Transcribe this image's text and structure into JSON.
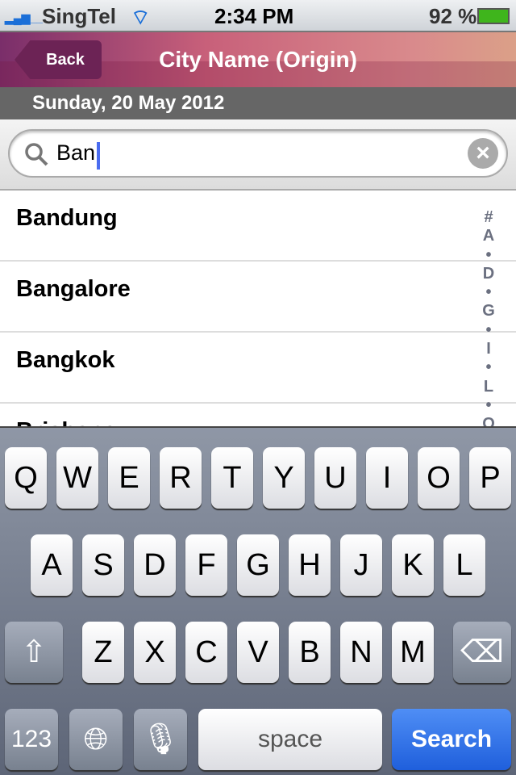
{
  "status": {
    "carrier": "SingTel",
    "time": "2:34 PM",
    "battery": "92 %",
    "battery_level": 0.92
  },
  "nav": {
    "back_label": "Back",
    "title": "City Name (Origin)"
  },
  "date": "Sunday, 20 May 2012",
  "search": {
    "value": "Ban",
    "search_icon": "magnifier-icon",
    "clear_icon": "clear-icon"
  },
  "results": [
    "Bandung",
    "Bangalore",
    "Bangkok",
    "Brisbane"
  ],
  "index": [
    "#",
    "A",
    "•",
    "D",
    "•",
    "G",
    "•",
    "I",
    "•",
    "L",
    "•",
    "O"
  ],
  "keyboard": {
    "row1": [
      "Q",
      "W",
      "E",
      "R",
      "T",
      "Y",
      "U",
      "I",
      "O",
      "P"
    ],
    "row2": [
      "A",
      "S",
      "D",
      "F",
      "G",
      "H",
      "J",
      "K",
      "L"
    ],
    "row3": [
      "Z",
      "X",
      "C",
      "V",
      "B",
      "N",
      "M"
    ],
    "numbers": "123",
    "space": "space",
    "search": "Search"
  },
  "colors": {
    "accent": "#1f5fdc",
    "nav": "#c8607a"
  }
}
